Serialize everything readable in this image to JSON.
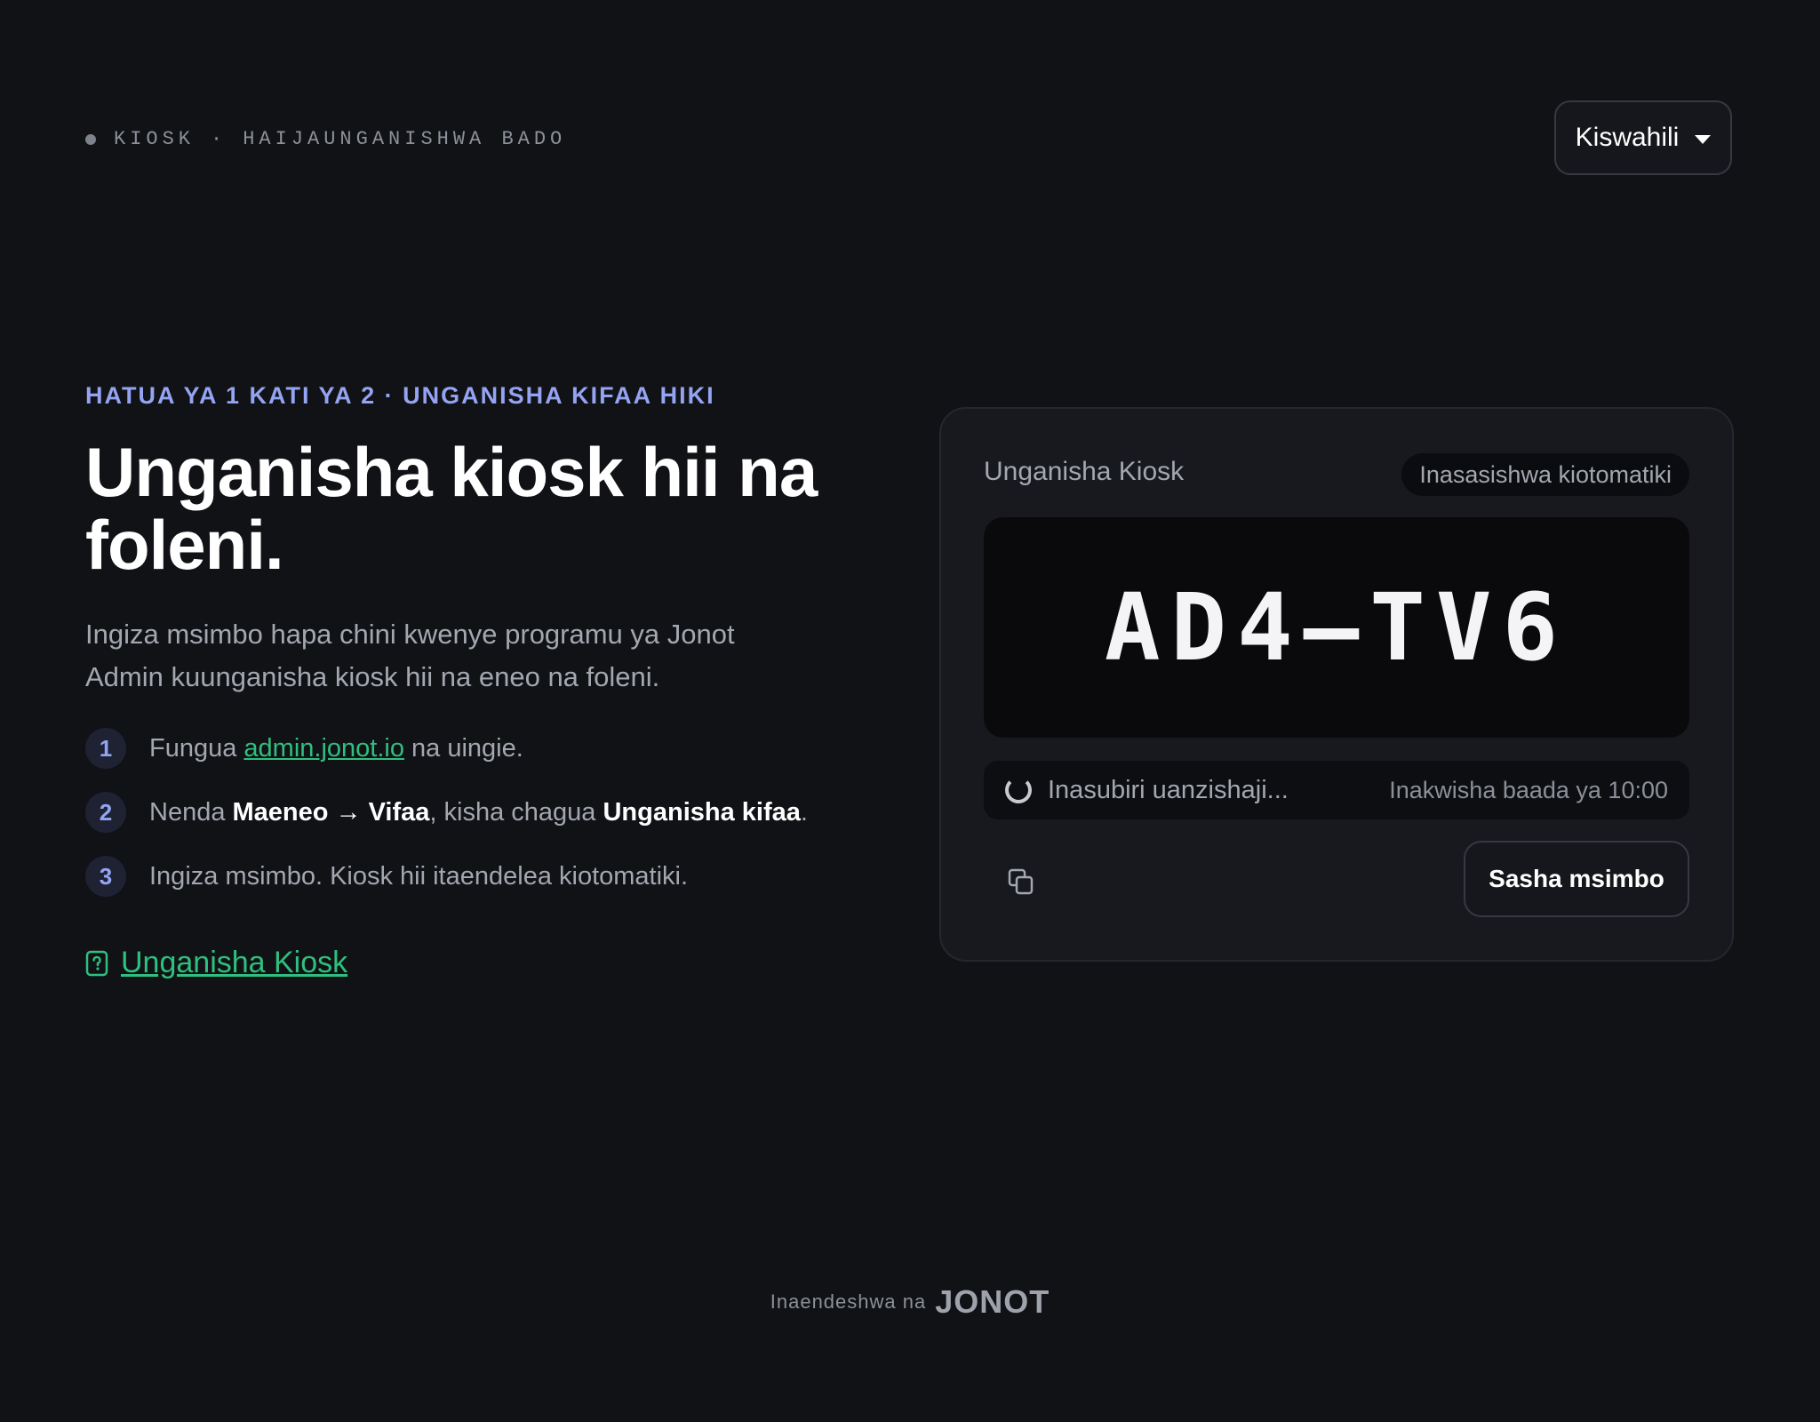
{
  "status_bar": {
    "kiosk_label": "KIOSK",
    "separator": "·",
    "state": "HAIJAUNGANISHWA BADO"
  },
  "language": {
    "selected": "Kiswahili"
  },
  "intro": {
    "step_kicker": "HATUA YA 1 KATI YA 2 · UNGANISHA KIFAA HIKI",
    "headline": "Unganisha kiosk hii na foleni.",
    "lead": "Ingiza msimbo hapa chini kwenye programu ya Jonot Admin kuunganisha kiosk hii na eneo na foleni."
  },
  "steps": [
    {
      "number": "1",
      "before": "Fungua ",
      "link": "admin.jonot.io",
      "after": " na uingie."
    },
    {
      "number": "2",
      "before": "Nenda ",
      "bold1": "Maeneo → Vifaa",
      "middle": ", kisha chagua ",
      "bold2": "Unganisha kifaa",
      "after": "."
    },
    {
      "number": "3",
      "text": "Ingiza msimbo. Kiosk hii itaendelea kiotomatiki."
    }
  ],
  "help_link": {
    "label": "Unganisha Kiosk",
    "icon": "help-document-icon"
  },
  "card": {
    "title": "Unganisha Kiosk",
    "auto_badge": "Inasasishwa kiotomatiki",
    "code": "AD4–TV6",
    "waiting": "Inasubiri uanzishaji...",
    "expires": "Inakwisha baada ya 10:00",
    "copy_icon": "copy-icon",
    "refresh_button": "Sasha msimbo"
  },
  "footer": {
    "powered_by": "Inaendeshwa na",
    "brand": "JONOT"
  },
  "colors": {
    "background": "#111216",
    "accent": "#94a4f2",
    "link": "#2fbf7e",
    "card": "#18191e"
  }
}
